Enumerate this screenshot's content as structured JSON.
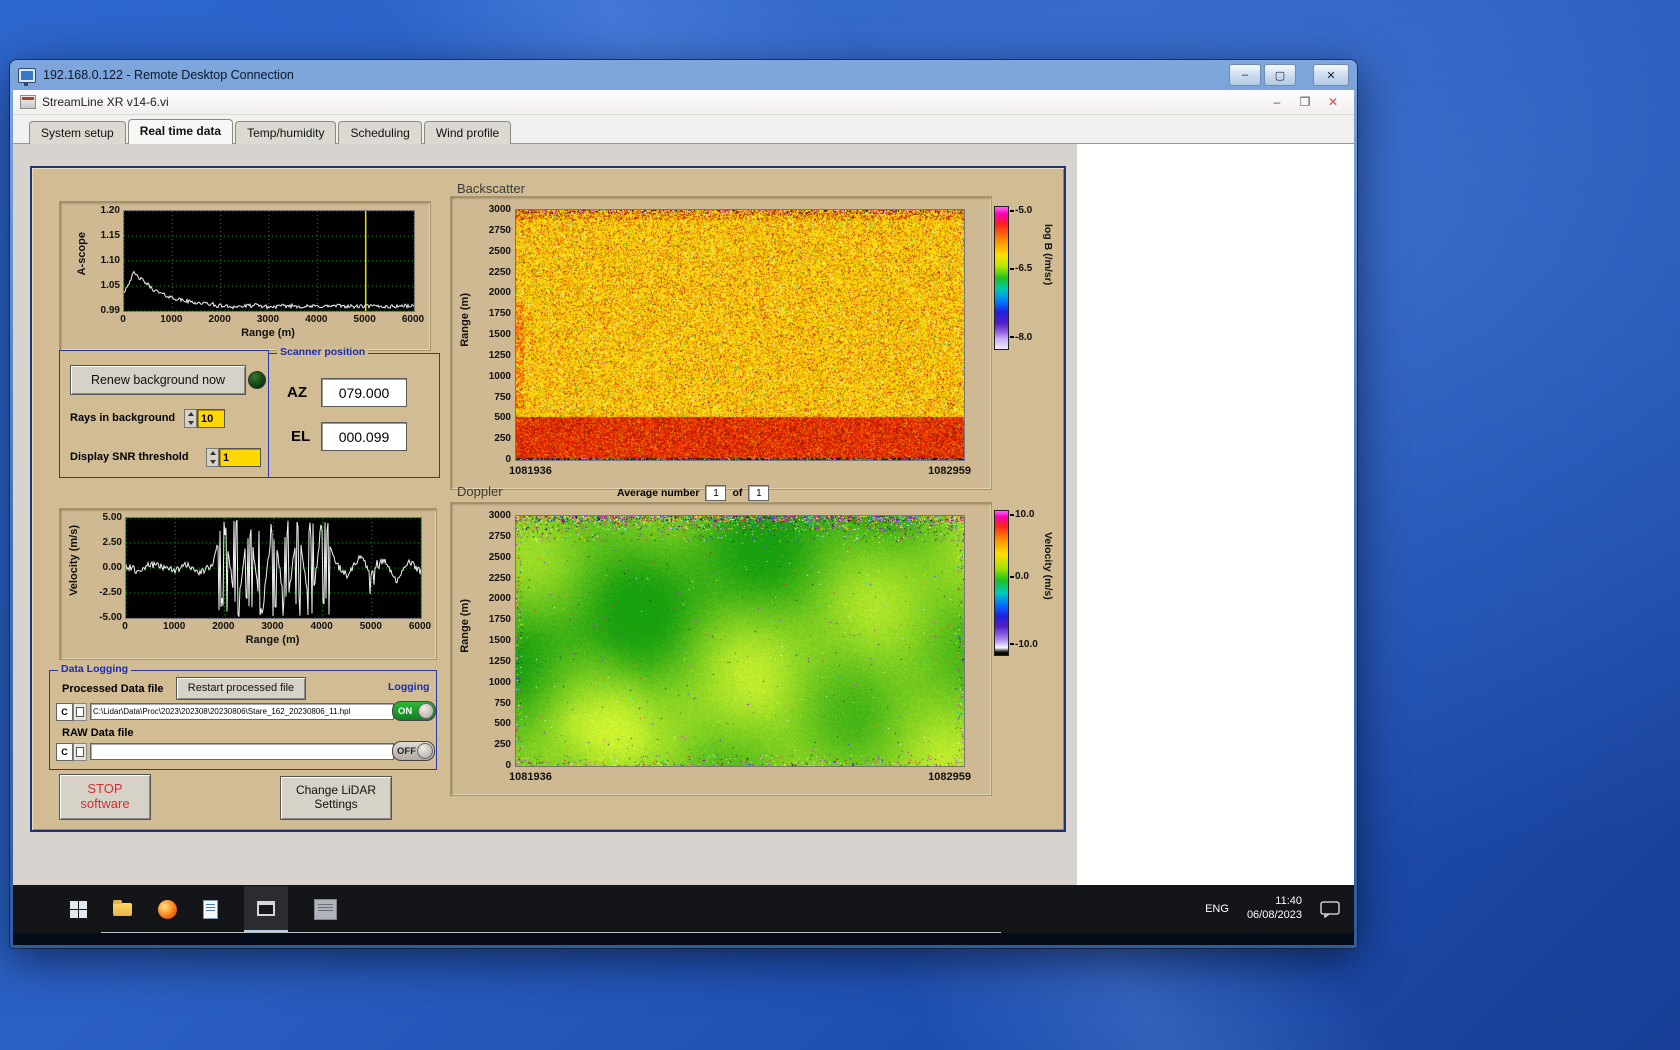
{
  "rdp": {
    "title": "192.168.0.122 - Remote Desktop Connection",
    "min": "–",
    "max": "▢",
    "close": "✕"
  },
  "app": {
    "title": "StreamLine XR v14-6.vi",
    "min": "–",
    "restore": "❐",
    "close": "✕",
    "tabs": [
      {
        "label": "System setup",
        "active": false
      },
      {
        "label": "Real time data",
        "active": true
      },
      {
        "label": "Temp/humidity",
        "active": false
      },
      {
        "label": "Scheduling",
        "active": false
      },
      {
        "label": "Wind profile",
        "active": false
      }
    ]
  },
  "panel": {
    "renew_button": "Renew background now",
    "rays_label": "Rays in background",
    "rays_value": "10",
    "snr_label": "Display SNR threshold",
    "snr_value": "1",
    "scanner": {
      "title": "Scanner position",
      "az_label": "AZ",
      "az_value": "079.000",
      "el_label": "EL",
      "el_value": "000.099"
    },
    "logging": {
      "box_label": "Data Logging",
      "processed_label": "Processed Data file",
      "restart_button": "Restart processed file",
      "logging_label": "Logging",
      "drive": "C",
      "processed_path": "C:\\Lidar\\Data\\Proc\\2023\\202308\\20230806\\Stare_162_20230806_11.hpl",
      "raw_label": "RAW Data file",
      "raw_path": "",
      "on_label": "ON",
      "off_label": "OFF"
    },
    "stop_line1": "STOP",
    "stop_line2": "software",
    "settings_line1": "Change LiDAR",
    "settings_line2": "Settings"
  },
  "taskbar": {
    "lang": "ENG",
    "time": "11:40",
    "date": "06/08/2023"
  },
  "chart_data": [
    {
      "id": "ascope",
      "type": "line",
      "ylabel": "A-scope",
      "xlabel": "Range (m)",
      "yticks": [
        "1.20",
        "1.15",
        "1.10",
        "1.05",
        "0.99"
      ],
      "xticks": [
        "0",
        "1000",
        "2000",
        "3000",
        "4000",
        "5000",
        "6000"
      ],
      "xlim": [
        0,
        6000
      ],
      "ylim": [
        0.99,
        1.2
      ],
      "grid": true,
      "cursor_x": 5000,
      "cursor_color": "#e6e600",
      "line_color": "#f0f0f0",
      "x_step": 250,
      "values": [
        1.03,
        1.065,
        1.045,
        1.02,
        1.01,
        1.004,
        1.001,
        1.0,
        1.001,
        0.999,
        1.0,
        1.002,
        0.998,
        1.0,
        1.001,
        0.999,
        1.0,
        1.0,
        1.001,
        0.999,
        1.0,
        1.0,
        0.999,
        1.001,
        1.0
      ]
    },
    {
      "id": "backscatter",
      "type": "heatmap",
      "title": "Backscatter",
      "ylabel": "Range (m)",
      "yticks": [
        "3000",
        "2750",
        "2500",
        "2250",
        "2000",
        "1750",
        "1500",
        "1250",
        "1000",
        "750",
        "500",
        "250",
        "0"
      ],
      "ylim": [
        0,
        3000
      ],
      "x_start": "1081936",
      "x_end": "1082959",
      "colorbar": {
        "label": "log B (/m/sr)",
        "ticks": [
          "-5.0",
          "-6.5",
          "-8.0"
        ],
        "tick_pos": [
          0.03,
          0.44,
          0.92
        ]
      },
      "pattern": "yellow-orange speckle aloft, solid red band below ~500 m, dark multicolour speckle strip at ground"
    },
    {
      "id": "velocity",
      "type": "line",
      "ylabel": "Velocity (m/s)",
      "xlabel": "Range (m)",
      "yticks": [
        "5.00",
        "2.50",
        "0.00",
        "-2.50",
        "-5.00"
      ],
      "xticks": [
        "0",
        "1000",
        "2000",
        "3000",
        "4000",
        "5000",
        "6000"
      ],
      "xlim": [
        0,
        6000
      ],
      "ylim": [
        -5,
        5
      ],
      "grid": true,
      "line_color": "#f0f0f0",
      "x_step": 250,
      "values": [
        0.2,
        -0.3,
        0.4,
        0.1,
        -0.2,
        0.3,
        -0.4,
        0.2,
        4.8,
        -4.9,
        5.0,
        -4.7,
        4.9,
        -5.0,
        4.6,
        -4.8,
        4.9,
        0.5,
        -0.8,
        1.2,
        -0.6,
        0.9,
        -1.5,
        0.7,
        -0.4
      ]
    },
    {
      "id": "doppler",
      "type": "heatmap",
      "title": "Doppler",
      "ylabel": "Range (m)",
      "yticks": [
        "3000",
        "2750",
        "2500",
        "2250",
        "2000",
        "1750",
        "1500",
        "1250",
        "1000",
        "750",
        "500",
        "250",
        "0"
      ],
      "ylim": [
        0,
        3000
      ],
      "x_start": "1081936",
      "x_end": "1082959",
      "colorbar": {
        "label": "Velocity (m/s)",
        "ticks": [
          "10.0",
          "0.0",
          "-10.0"
        ],
        "tick_pos": [
          0.03,
          0.46,
          0.93
        ]
      },
      "average": {
        "label": "Average number",
        "value": "1",
        "of_label": "of",
        "of_value": "1"
      },
      "pattern": "near-zero green velocity field with yellow-green patches; multicolour speckle along top edge and ground"
    }
  ]
}
